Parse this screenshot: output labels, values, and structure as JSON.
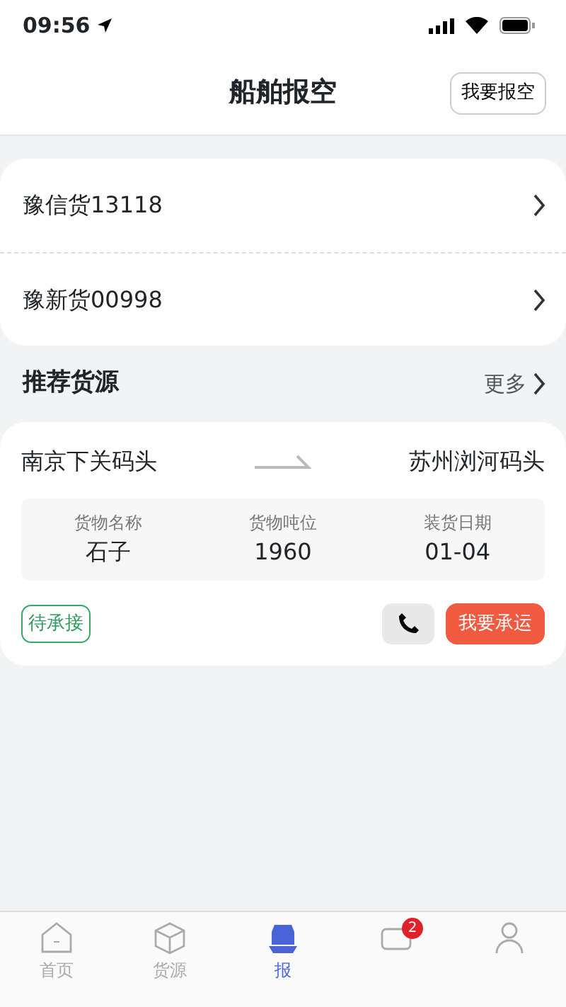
{
  "status_bar": {
    "time": "09:56"
  },
  "header": {
    "title": "船舶报空",
    "action": "我要报空"
  },
  "ships": [
    {
      "name": "豫信货13118"
    },
    {
      "name": "豫新货00998"
    }
  ],
  "section": {
    "title": "推荐货源",
    "more": "更多"
  },
  "cargo": [
    {
      "from": "南京下关码头",
      "to": "苏州浏河码头",
      "fields": [
        {
          "label": "货物名称",
          "value": "石子"
        },
        {
          "label": "货物吨位",
          "value": "1960"
        },
        {
          "label": "装货日期",
          "value": "01-04"
        }
      ],
      "status": "待承接",
      "action": "我要承运"
    }
  ],
  "tabbar": [
    {
      "label": "首页",
      "kind": "home",
      "selected": false
    },
    {
      "label": "货源",
      "kind": "box",
      "selected": false
    },
    {
      "label": "报",
      "kind": "ship",
      "selected": true
    },
    {
      "kind": "message",
      "badge": "2",
      "selected": false
    },
    {
      "kind": "person",
      "selected": false
    }
  ]
}
